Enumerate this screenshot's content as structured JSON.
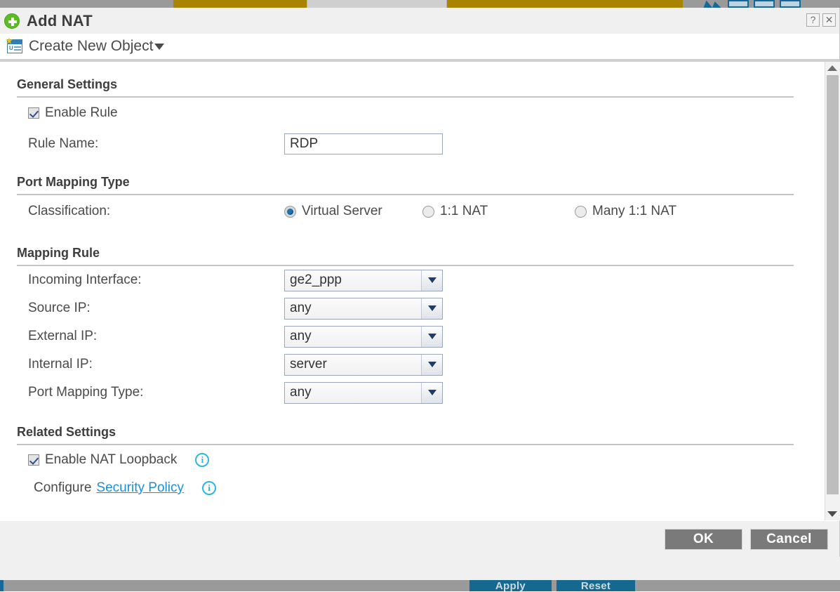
{
  "backdrop": {
    "apply_label": "Apply",
    "reset_label": "Reset",
    "gold_color": "#a88400",
    "accent_color": "#14689a"
  },
  "dialog": {
    "title": "Add NAT",
    "add_icon": "plus-circle-icon",
    "help_button": "?",
    "close_button": "✕",
    "toolbar": {
      "create_new_object": "Create New Object",
      "object_icon": "create-object-icon",
      "caret": "▼"
    },
    "sections": {
      "general": {
        "heading": "General Settings",
        "enable_rule_label": "Enable Rule",
        "enable_rule_checked": true,
        "rule_name_label": "Rule Name:",
        "rule_name_value": "RDP",
        "rule_name_placeholder": ""
      },
      "port_mapping_type": {
        "heading": "Port Mapping Type",
        "classification_label": "Classification:",
        "options": [
          {
            "label": "Virtual Server",
            "selected": true
          },
          {
            "label": "1:1 NAT",
            "selected": false
          },
          {
            "label": "Many 1:1 NAT",
            "selected": false
          }
        ]
      },
      "mapping_rule": {
        "heading": "Mapping Rule",
        "fields": [
          {
            "label": "Incoming Interface:",
            "value": "ge2_ppp"
          },
          {
            "label": "Source IP:",
            "value": "any"
          },
          {
            "label": "External IP:",
            "value": "any"
          },
          {
            "label": "Internal IP:",
            "value": "server"
          },
          {
            "label": "Port Mapping Type:",
            "value": "any"
          }
        ]
      },
      "related": {
        "heading": "Related Settings",
        "nat_loopback_label": "Enable NAT Loopback",
        "nat_loopback_checked": true,
        "configure_prefix": "Configure",
        "security_policy_link": "Security Policy",
        "info_icon": "info-icon"
      }
    },
    "footer": {
      "ok_label": "OK",
      "cancel_label": "Cancel"
    },
    "scrollbar": {
      "up_arrow": "▲",
      "down_arrow": "▼"
    }
  }
}
